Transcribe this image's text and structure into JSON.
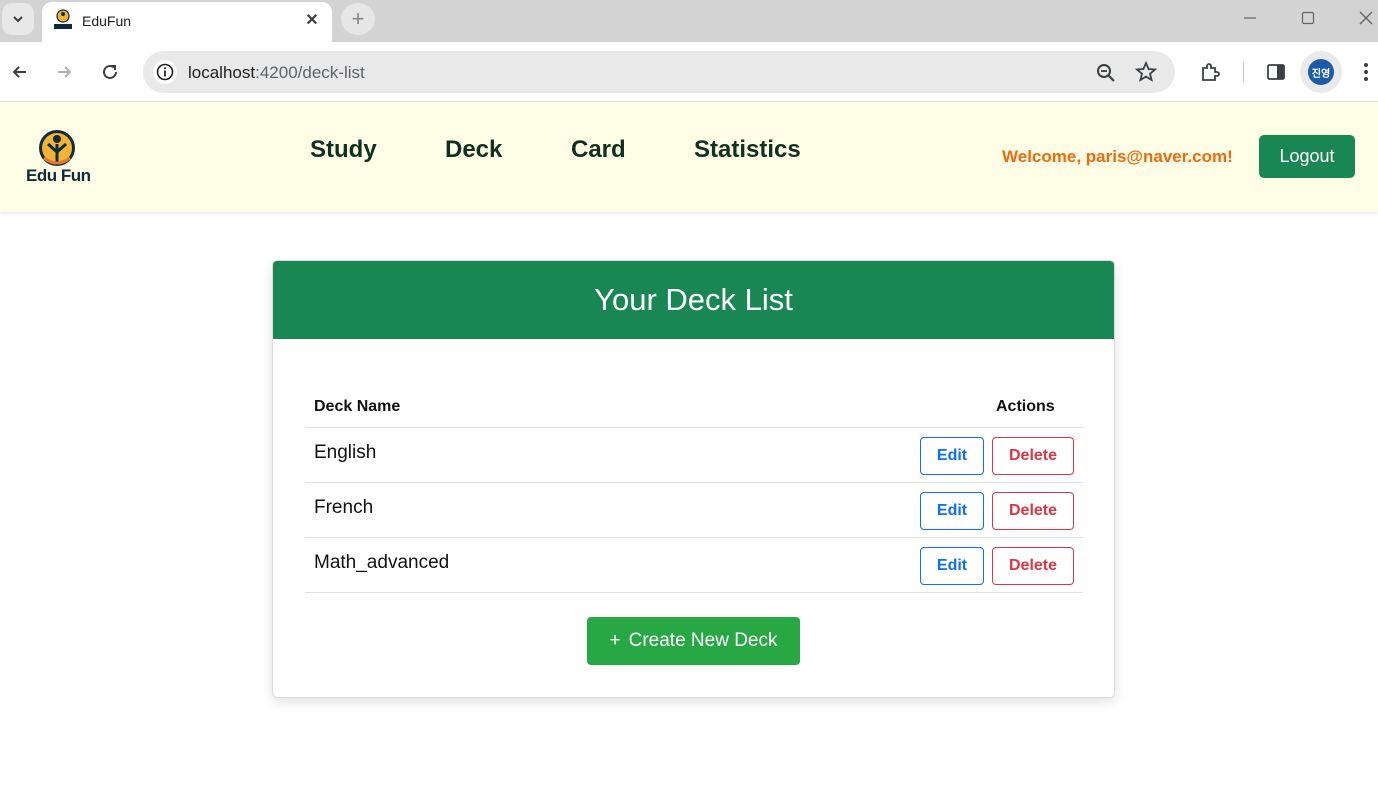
{
  "browser": {
    "tab_title": "EduFun",
    "url_host": "localhost",
    "url_path": ":4200/deck-list",
    "profile_label": "진영"
  },
  "header": {
    "logo_text": "Edu Fun",
    "nav": [
      "Study",
      "Deck",
      "Card",
      "Statistics"
    ],
    "welcome": "Welcome, paris@naver.com!",
    "logout_label": "Logout"
  },
  "deck_list": {
    "title": "Your Deck List",
    "col_name": "Deck Name",
    "col_actions": "Actions",
    "rows": [
      {
        "name": "English",
        "edit": "Edit",
        "delete": "Delete"
      },
      {
        "name": "French",
        "edit": "Edit",
        "delete": "Delete"
      },
      {
        "name": "Math_advanced",
        "edit": "Edit",
        "delete": "Delete"
      }
    ],
    "create_label": "Create New Deck",
    "create_icon": "+"
  },
  "colors": {
    "primary_green": "#198754",
    "create_green": "#28a745",
    "welcome_orange": "#f06a0d",
    "edit_blue": "#0d6efd",
    "delete_red": "#dc3545",
    "header_bg": "#fefee6"
  }
}
